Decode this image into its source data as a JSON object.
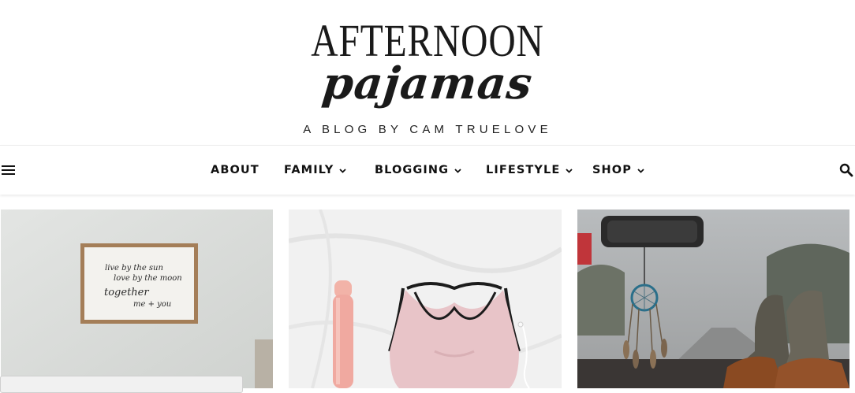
{
  "site": {
    "logo_line1": "AFTERNOON",
    "logo_line2": "pajamas",
    "tagline": "A BLOG BY CAM TRUELOVE"
  },
  "nav": {
    "menu_icon": "hamburger-menu-icon",
    "search_icon": "search-icon",
    "items": [
      {
        "label": "ABOUT",
        "dropdown": false
      },
      {
        "label": "FAMILY",
        "dropdown": true
      },
      {
        "label": "BLOGGING",
        "dropdown": true
      },
      {
        "label": "LIFESTYLE",
        "dropdown": true
      },
      {
        "label": "SHOP",
        "dropdown": true
      }
    ]
  },
  "posts": [
    {
      "image": "framed-sign-on-wall",
      "sign_text": [
        "live by the sun",
        "love by the moon",
        "together",
        "me + you"
      ]
    },
    {
      "image": "water-bottle-and-pink-sports-bra"
    },
    {
      "image": "dreamcatcher-and-duck-boots-in-car"
    }
  ],
  "colors": {
    "text": "#111111",
    "background": "#ffffff",
    "bra_pink": "#e8c4c8",
    "bottle_pink": "#f0a9a0"
  }
}
